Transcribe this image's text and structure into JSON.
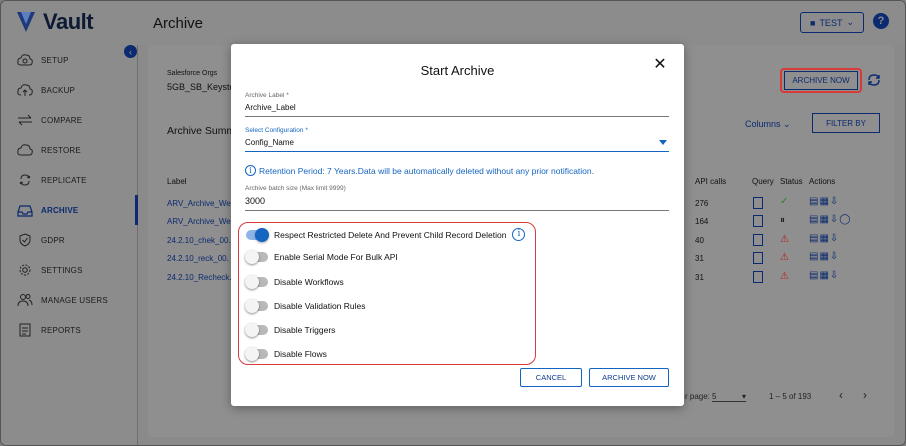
{
  "app": {
    "brand": "Vault",
    "page_title": "Archive",
    "user_label": "TEST"
  },
  "sidebar": {
    "items": [
      {
        "label": "SETUP",
        "icon": "cloud-gear-icon"
      },
      {
        "label": "BACKUP",
        "icon": "cloud-upload-icon"
      },
      {
        "label": "COMPARE",
        "icon": "compare-arrows-icon"
      },
      {
        "label": "RESTORE",
        "icon": "cloud-restore-icon"
      },
      {
        "label": "REPLICATE",
        "icon": "replicate-icon"
      },
      {
        "label": "ARCHIVE",
        "icon": "archive-icon",
        "active": true
      },
      {
        "label": "GDPR",
        "icon": "shield-check-icon"
      },
      {
        "label": "SETTINGS",
        "icon": "gear-icon"
      },
      {
        "label": "MANAGE USERS",
        "icon": "users-icon"
      },
      {
        "label": "REPORTS",
        "icon": "report-icon"
      }
    ]
  },
  "background": {
    "org_label": "Salesforce Orgs",
    "org_value": "5GB_SB_Keysto",
    "summary_title": "Archive Summ",
    "archive_now": "ARCHIVE NOW",
    "columns": "Columns",
    "filter_by": "FILTER BY",
    "headers": {
      "label": "Label",
      "api_calls": "API calls",
      "query": "Query",
      "status": "Status",
      "actions": "Actions"
    },
    "rows": [
      {
        "label": "ARV_Archive_Wed",
        "api_calls": "276",
        "status": "success"
      },
      {
        "label": "ARV_Archive_Wed",
        "api_calls": "164",
        "status": "paused"
      },
      {
        "label": "24.2.10_chek_00.",
        "api_calls": "40",
        "status": "warning"
      },
      {
        "label": "24.2.10_reck_00.",
        "api_calls": "31",
        "status": "warning"
      },
      {
        "label": "24.2.10_Recheck.",
        "api_calls": "31",
        "status": "warning"
      }
    ],
    "per_page_label": "r page:",
    "per_page_value": "5",
    "range": "1 – 5 of 193"
  },
  "modal": {
    "title": "Start Archive",
    "archive_label_caption": "Archive Label *",
    "archive_label_value": "Archive_Label",
    "config_caption": "Select Configuration *",
    "config_value": "Config_Name",
    "retention_text": "Retention Period: 7 Years.Data will be automatically deleted without any prior notification.",
    "batch_caption": "Archive batch size (Max limit 9999)",
    "batch_value": "3000",
    "options": [
      {
        "label": "Respect Restricted Delete And Prevent Child Record Deletion",
        "on": true
      },
      {
        "label": "Enable Serial Mode For Bulk API",
        "on": false
      },
      {
        "label": "Disable Workflows",
        "on": false
      },
      {
        "label": "Disable Validation Rules",
        "on": false
      },
      {
        "label": "Disable Triggers",
        "on": false
      },
      {
        "label": "Disable Flows",
        "on": false
      }
    ],
    "cancel": "CANCEL",
    "archive_now": "ARCHIVE NOW"
  },
  "colors": {
    "primary": "#0b2a6f",
    "accent": "#1565c0",
    "highlight": "#d93a3a"
  }
}
